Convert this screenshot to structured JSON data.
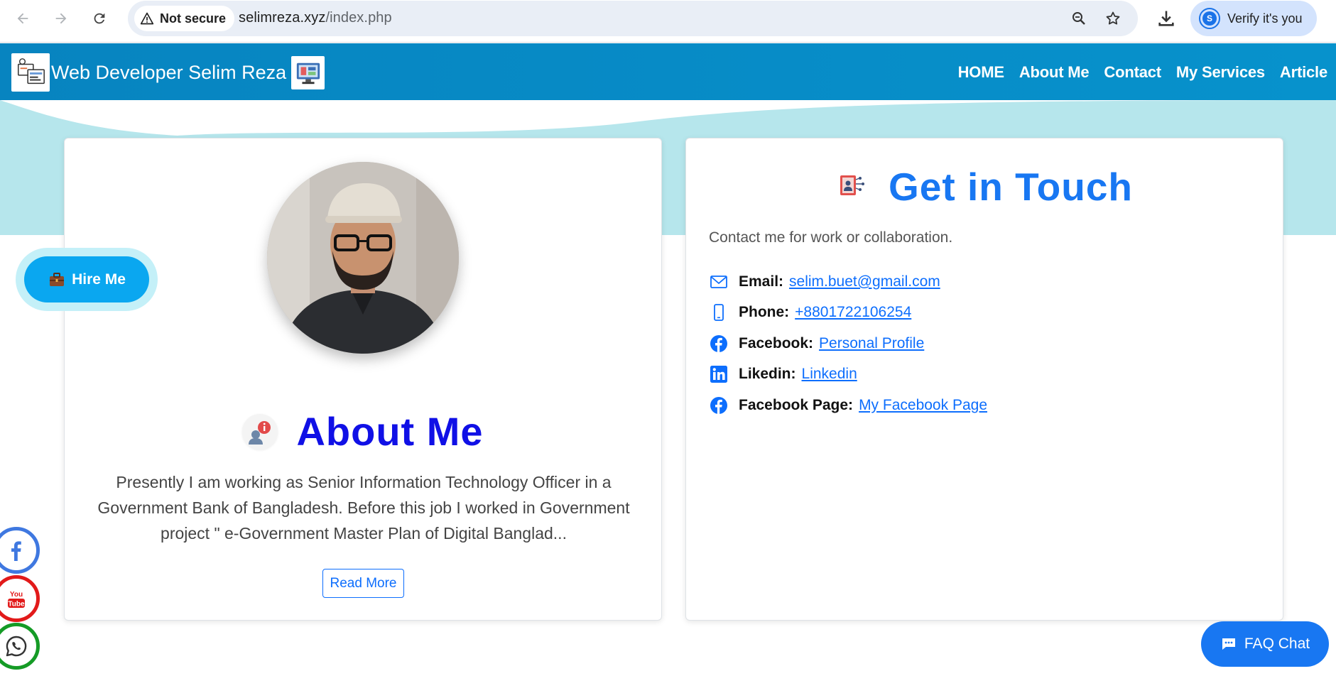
{
  "browser": {
    "security_label": "Not secure",
    "url_host": "selimreza.xyz",
    "url_path": "/index.php",
    "profile_initial": "S",
    "profile_label": "Verify it's you"
  },
  "site": {
    "brand": "Web Developer Selim Reza",
    "nav": [
      "HOME",
      "About Me",
      "Contact",
      "My Services",
      "Article"
    ]
  },
  "about": {
    "title": "About Me",
    "text": "Presently I am working as Senior Information Technology Officer in a Government Bank of Bangladesh. Before this job I worked in Government project \" e-Government Master Plan of Digital Banglad...",
    "read_more": "Read More"
  },
  "contact": {
    "title": "Get in Touch",
    "intro": "Contact me for work or collaboration.",
    "items": [
      {
        "label": "Email:",
        "value": "selim.buet@gmail.com",
        "icon": "envelope-icon"
      },
      {
        "label": "Phone:",
        "value": "+8801722106254",
        "icon": "phone-icon"
      },
      {
        "label": "Facebook:",
        "value": "Personal Profile",
        "icon": "facebook-icon"
      },
      {
        "label": "Likedin:",
        "value": "Linkedin",
        "icon": "linkedin-icon"
      },
      {
        "label": "Facebook Page:",
        "value": "My Facebook Page",
        "icon": "facebook-icon"
      }
    ]
  },
  "floating": {
    "hire_label": "Hire Me",
    "faq_label": "FAQ Chat"
  },
  "colors": {
    "navbar": "#0784c0",
    "hero_bg": "#b6e6ec",
    "about_title": "#1010e6",
    "contact_title": "#1877f2",
    "link": "#0d6efd"
  }
}
